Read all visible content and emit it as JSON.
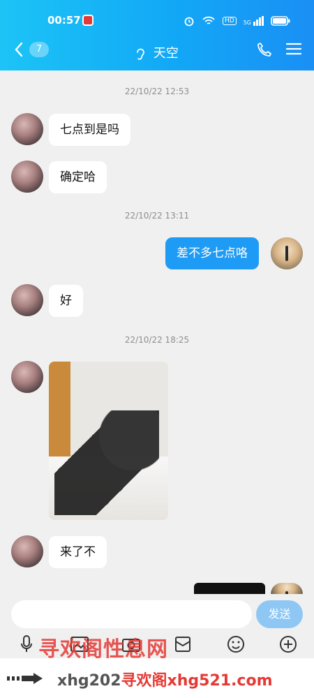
{
  "status_bar": {
    "time": "00:57",
    "signal_label": "5G",
    "battery_label": "HD"
  },
  "nav": {
    "back_count": "7",
    "title": "天空"
  },
  "messages": [
    {
      "type": "timestamp",
      "text": "22/10/22 12:53"
    },
    {
      "type": "in",
      "text": "七点到是吗"
    },
    {
      "type": "in",
      "text": "确定哈"
    },
    {
      "type": "timestamp",
      "text": "22/10/22 13:11"
    },
    {
      "type": "out",
      "text": "差不多七点咯"
    },
    {
      "type": "in",
      "text": "好"
    },
    {
      "type": "timestamp",
      "text": "22/10/22 18:25"
    },
    {
      "type": "in-image"
    },
    {
      "type": "in",
      "text": "来了不"
    }
  ],
  "composer": {
    "input_value": "",
    "send_label": "发送"
  },
  "watermark": {
    "top": "寻欢阁性息网",
    "bottom_left": "xhg202",
    "bottom_right": "寻欢阁xhg521.com"
  },
  "colors": {
    "header_from": "#1cc4f6",
    "header_to": "#1a8ff5",
    "outgoing_bubble": "#1e9bf5",
    "send_button": "#8fc7f4",
    "watermark": "#e53935"
  }
}
